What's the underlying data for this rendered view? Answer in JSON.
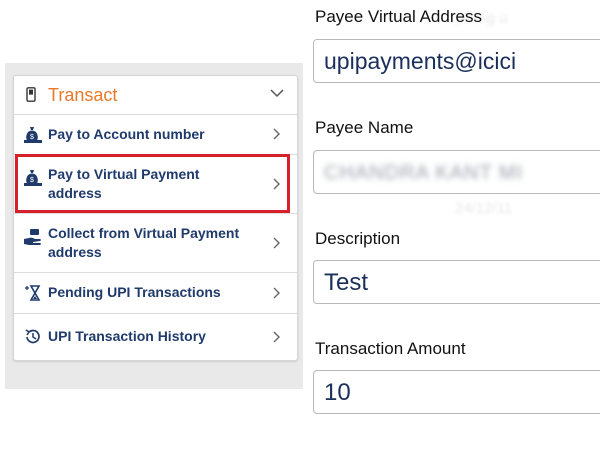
{
  "transact_menu": {
    "title": "Transact",
    "header_icon": "phone-icon",
    "collapse_icon": "chevron-up-icon",
    "items": [
      {
        "label": "Pay to Account number",
        "icon": "money-bag-icon"
      },
      {
        "label": "Pay to Virtual Payment address",
        "icon": "money-bag-icon",
        "highlighted": true
      },
      {
        "label": "Collect from Virtual Payment address",
        "icon": "hand-money-icon"
      },
      {
        "label": "Pending UPI Transactions",
        "icon": "hourglass-icon"
      },
      {
        "label": "UPI Transaction History",
        "icon": "history-icon"
      }
    ],
    "highlight_color": "#d6202a",
    "accent_color": "#e8782a"
  },
  "form": {
    "payee_vpa": {
      "label": "Payee Virtual Address",
      "value": "upipayments@icici"
    },
    "payee_name": {
      "label": "Payee Name",
      "value": "CHANDRA KANT MI"
    },
    "description": {
      "label": "Description",
      "value": "Test"
    },
    "amount": {
      "label": "Transaction Amount",
      "value": "10"
    }
  }
}
